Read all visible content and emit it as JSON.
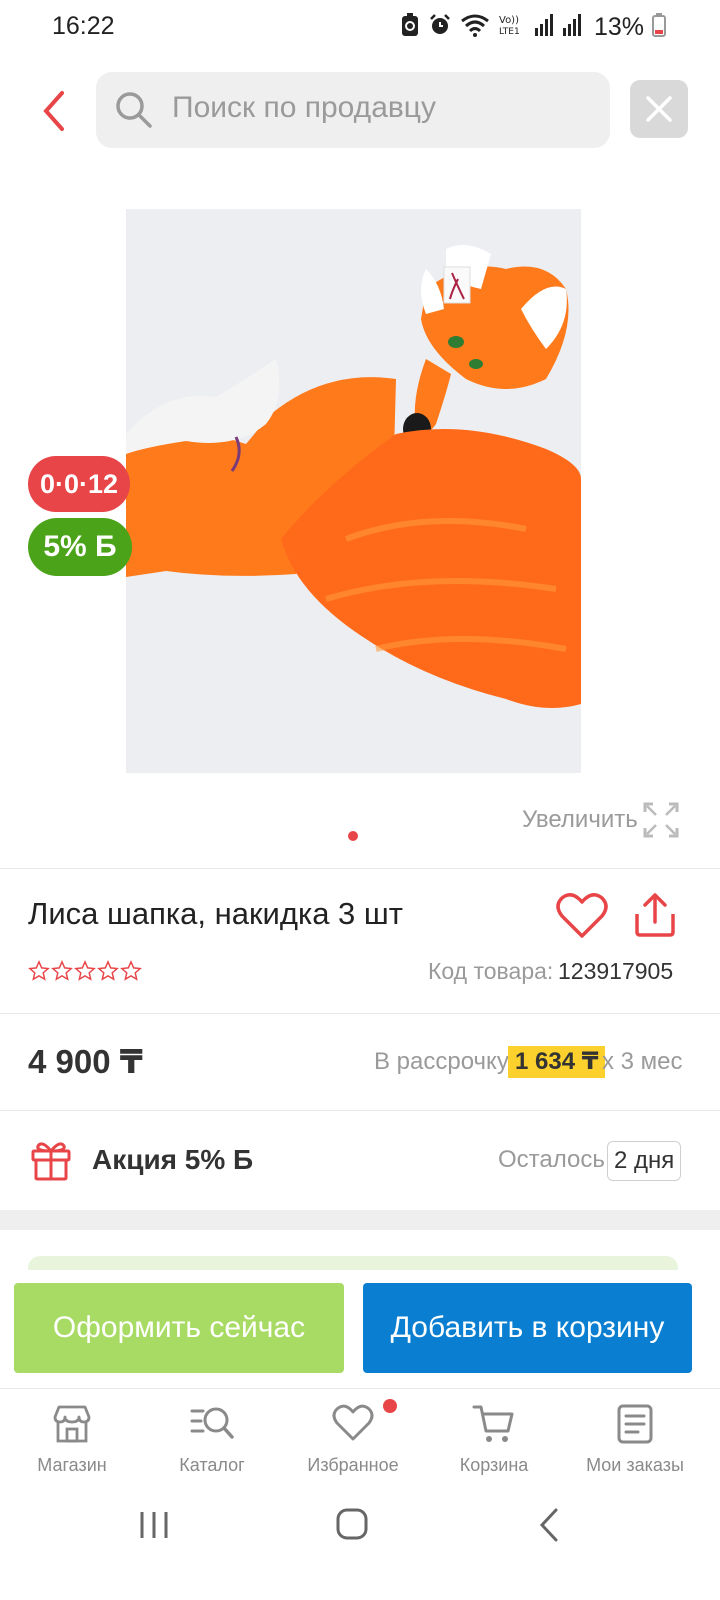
{
  "status_bar": {
    "time": "16:22",
    "battery": "13%",
    "network": "LTE1"
  },
  "search": {
    "placeholder": "Поиск по продавцу"
  },
  "product": {
    "timer_badge": "0·0·12",
    "bonus_badge": "5% Б",
    "zoom_label": "Увеличить",
    "title": "Лиса шапка, накидка 3 шт",
    "sku_label": "Код товара:",
    "sku_value": "123917905",
    "price": "4 900 ₸",
    "installment_label": "В рассрочку",
    "installment_amount": "1 634 ₸",
    "installment_term": "х 3 мес",
    "rating_stars": 0,
    "image_count": 1,
    "image_index": 1
  },
  "promo": {
    "label": "Акция 5% Б",
    "remain_label": "Осталось",
    "remain_value": "2 дня"
  },
  "actions": {
    "checkout_label": "Оформить сейчас",
    "add_to_cart_label": "Добавить в корзину"
  },
  "bottom_nav": {
    "items": [
      {
        "label": "Магазин",
        "icon": "store-icon"
      },
      {
        "label": "Каталог",
        "icon": "catalog-search-icon"
      },
      {
        "label": "Избранное",
        "icon": "heart-icon"
      },
      {
        "label": "Корзина",
        "icon": "cart-icon"
      },
      {
        "label": "Мои заказы",
        "icon": "orders-icon"
      }
    ]
  },
  "colors": {
    "accent_red": "#e84548",
    "bonus_green": "#4ba31a",
    "checkout_green": "#a8db64",
    "cart_blue": "#0a7fd2",
    "installment_yellow": "#fcd12e"
  }
}
